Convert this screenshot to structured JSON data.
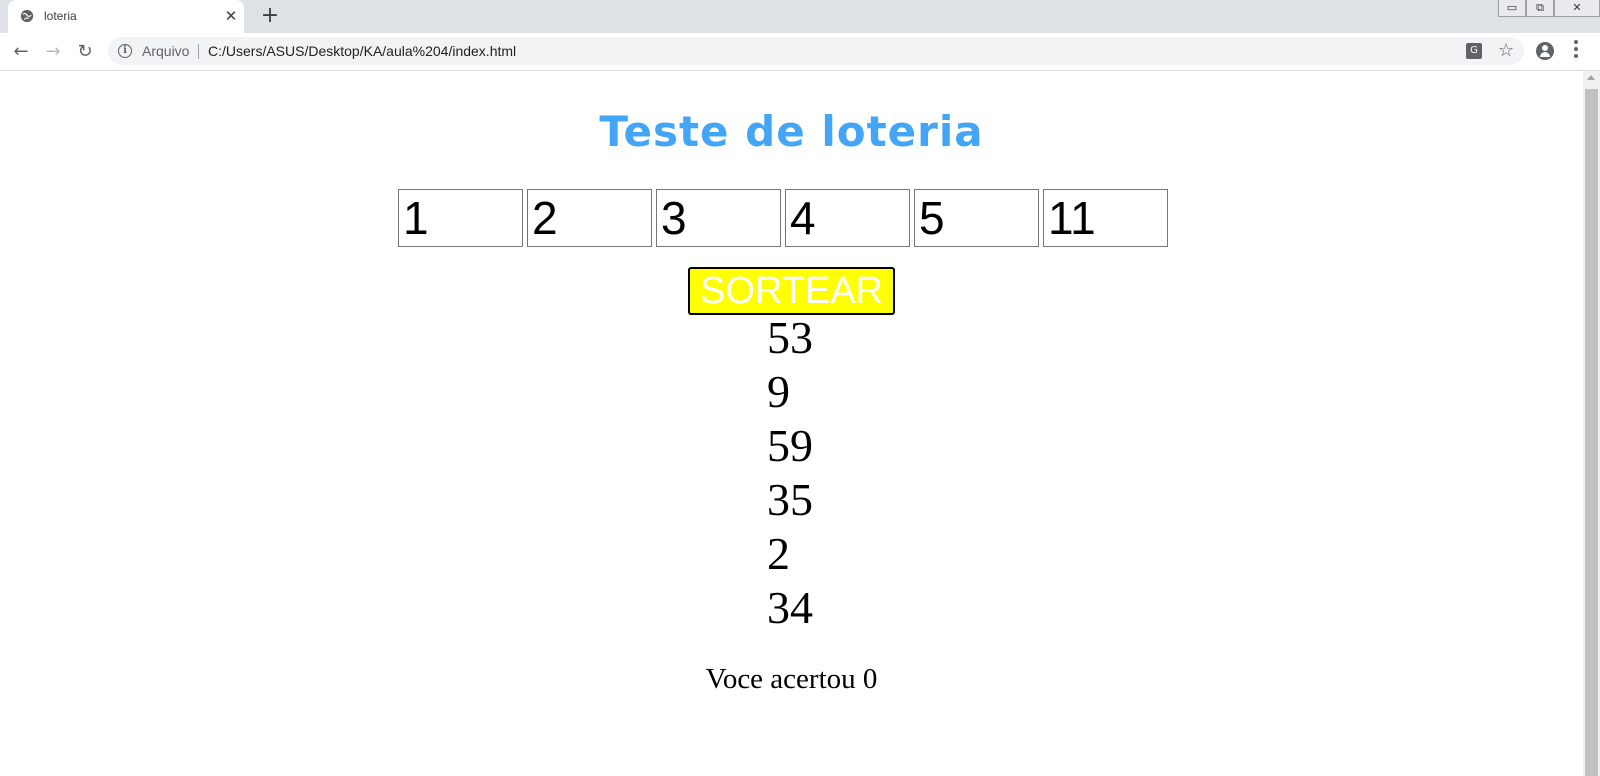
{
  "browser": {
    "tab_title": "loteria",
    "new_tab_label": "+",
    "close_tab_label": "✕",
    "back_label": "←",
    "forward_label": "→",
    "reload_label": "↻",
    "omnibox_scheme": "Arquivo",
    "omnibox_url": "C:/Users/ASUS/Desktop/KA/aula%204/index.html",
    "translate_label": "G",
    "bookmark_label": "☆",
    "window_controls": {
      "minimize": "▭",
      "restore": "⧉",
      "close": "✕"
    }
  },
  "page": {
    "title": "Teste de loteria",
    "inputs": [
      "1",
      "2",
      "3",
      "4",
      "5",
      "11"
    ],
    "draw_button_label": "SORTEAR",
    "draw_button_color": "#ffff00",
    "title_color": "#42a5f5",
    "drawn_numbers": [
      "53",
      "9",
      "59",
      "35",
      "2",
      "34"
    ],
    "score_text": "Voce acertou 0"
  }
}
